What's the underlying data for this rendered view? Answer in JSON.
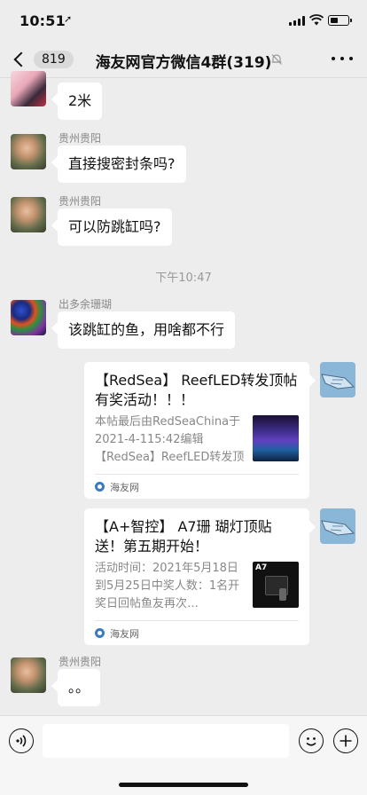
{
  "status_bar": {
    "time": "10:51",
    "battery_level": 0.45
  },
  "nav": {
    "back_badge": "819",
    "title": "海友网官方微信4群(319)"
  },
  "messages": [
    {
      "sender": "",
      "text": "2米"
    },
    {
      "sender": "贵州贵阳",
      "text": "直接搜密封条吗?"
    },
    {
      "sender": "贵州贵阳",
      "text": "可以防跳缸吗?"
    },
    {
      "sender": "出多余珊瑚",
      "text": "该跳缸的鱼，用啥都不行"
    },
    {
      "sender": "贵州贵阳",
      "text": "。。"
    }
  ],
  "time_separator": "下午10:47",
  "cards": [
    {
      "title": "【RedSea】 ReefLED转发顶帖有奖活动！！！",
      "desc": "本帖最后由RedSeaChina于2021-4-115:42编辑【RedSea】ReefLED转发顶帖有奖活动",
      "source": "海友网"
    },
    {
      "title": "【A+智控】 A7珊 瑚灯顶贴送！第五期开始！",
      "desc": "活动时间：2021年5月18日到5月25日中奖人数：1名开奖日回帖鱼友再次…",
      "source": "海友网",
      "thumb_text": "A7"
    }
  ],
  "icons": {
    "back": "chevron-left-icon",
    "mute": "mute-bell-icon",
    "more": "more-dots-icon",
    "voice": "voice-icon",
    "emoji": "emoji-icon",
    "plus": "plus-icon"
  }
}
